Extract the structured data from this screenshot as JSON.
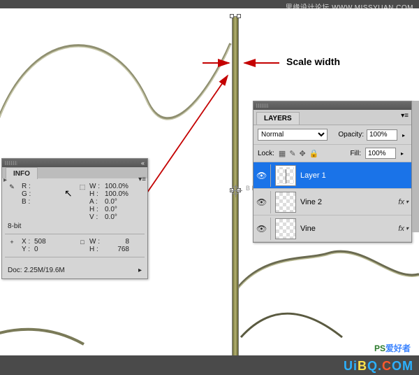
{
  "watermark_top": "思缘设计论坛 WWW.MISSYUAN.COM",
  "annotation_label": "Scale width",
  "info": {
    "title": "INFO",
    "r_label": "R :",
    "g_label": "G :",
    "b_label": "B :",
    "bit_label": "8-bit",
    "w1_label": "W :",
    "w1_value": "100.0%",
    "h1_label": "H :",
    "h1_value": "100.0%",
    "a_label": "A :",
    "a_value": "0.0°",
    "hskew_label": "H :",
    "hskew_value": "0.0°",
    "vskew_label": "V :",
    "vskew_value": "0.0°",
    "x_label": "X :",
    "x_value": "508",
    "y_label": "Y :",
    "y_value": "0",
    "w2_label": "W :",
    "w2_value": "8",
    "h2_label": "H :",
    "h2_value": "768",
    "doc_label": "Doc:",
    "doc_value": "2.25M/19.6M"
  },
  "layers": {
    "title": "LAYERS",
    "blend_label": "Normal",
    "opacity_label": "Opacity:",
    "opacity_value": "100%",
    "lock_label": "Lock:",
    "fill_label": "Fill:",
    "fill_value": "100%",
    "items": [
      {
        "name": "Layer 1",
        "selected": true,
        "fx": false
      },
      {
        "name": "Vine 2",
        "selected": false,
        "fx": true
      },
      {
        "name": "Vine",
        "selected": false,
        "fx": true
      }
    ],
    "fx_label": "fx"
  },
  "logo_small_ps": "PS",
  "logo_small_rest": "爱好者",
  "logo_bottom_text": "UiBQ.COM",
  "bb_label": "B B"
}
